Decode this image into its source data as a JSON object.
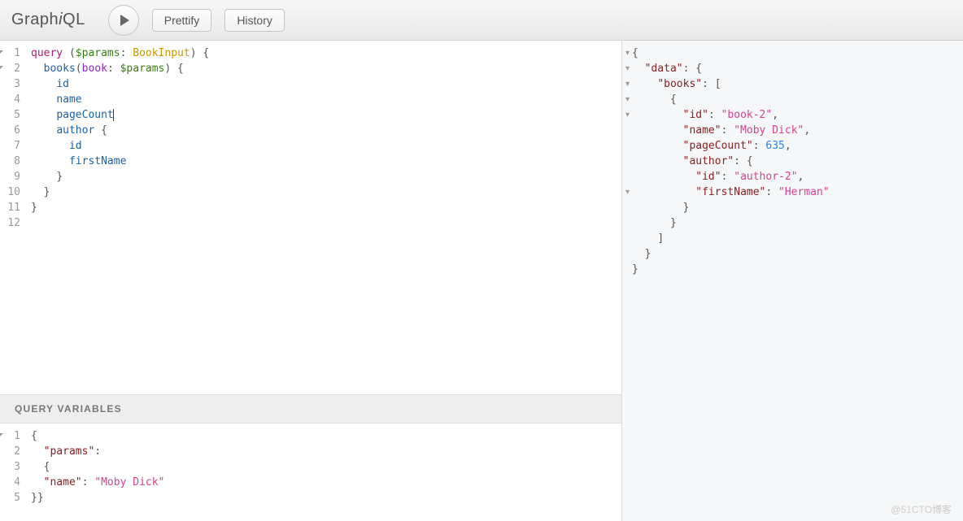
{
  "logo": "GraphiQL",
  "toolbar": {
    "prettify_label": "Prettify",
    "history_label": "History"
  },
  "query_editor": {
    "line_numbers": [
      "1",
      "2",
      "3",
      "4",
      "5",
      "6",
      "7",
      "8",
      "9",
      "10",
      "11",
      "12"
    ],
    "fold_lines": [
      1,
      2
    ],
    "tokens": [
      [
        {
          "t": "kw",
          "v": "query"
        },
        {
          "t": "sp",
          "v": " "
        },
        {
          "t": "punct",
          "v": "("
        },
        {
          "t": "var",
          "v": "$params"
        },
        {
          "t": "punct",
          "v": ": "
        },
        {
          "t": "type",
          "v": "BookInput"
        },
        {
          "t": "punct",
          "v": ") {"
        }
      ],
      [
        {
          "t": "sp",
          "v": "  "
        },
        {
          "t": "field",
          "v": "books"
        },
        {
          "t": "punct",
          "v": "("
        },
        {
          "t": "arg",
          "v": "book"
        },
        {
          "t": "punct",
          "v": ": "
        },
        {
          "t": "var",
          "v": "$params"
        },
        {
          "t": "punct",
          "v": ") {"
        }
      ],
      [
        {
          "t": "sp",
          "v": "    "
        },
        {
          "t": "field",
          "v": "id"
        }
      ],
      [
        {
          "t": "sp",
          "v": "    "
        },
        {
          "t": "field",
          "v": "name"
        }
      ],
      [
        {
          "t": "sp",
          "v": "    "
        },
        {
          "t": "field",
          "v": "pageCount"
        },
        {
          "t": "cursor",
          "v": ""
        }
      ],
      [
        {
          "t": "sp",
          "v": "    "
        },
        {
          "t": "field",
          "v": "author"
        },
        {
          "t": "punct",
          "v": " {"
        }
      ],
      [
        {
          "t": "sp",
          "v": "      "
        },
        {
          "t": "field",
          "v": "id"
        }
      ],
      [
        {
          "t": "sp",
          "v": "      "
        },
        {
          "t": "field",
          "v": "firstName"
        }
      ],
      [
        {
          "t": "sp",
          "v": "    "
        },
        {
          "t": "punct",
          "v": "}"
        }
      ],
      [
        {
          "t": "sp",
          "v": "  "
        },
        {
          "t": "punct",
          "v": "}"
        }
      ],
      [
        {
          "t": "punct",
          "v": "}"
        }
      ],
      []
    ]
  },
  "variables_header": "Query Variables",
  "variables_editor": {
    "line_numbers": [
      "1",
      "2",
      "3",
      "4",
      "5"
    ],
    "fold_lines": [
      1
    ],
    "tokens": [
      [
        {
          "t": "punct",
          "v": "{"
        }
      ],
      [
        {
          "t": "sp",
          "v": "  "
        },
        {
          "t": "key",
          "v": "\"params\""
        },
        {
          "t": "punct",
          "v": ":"
        }
      ],
      [
        {
          "t": "sp",
          "v": "  "
        },
        {
          "t": "punct",
          "v": "{"
        }
      ],
      [
        {
          "t": "sp",
          "v": "  "
        },
        {
          "t": "key",
          "v": "\"name\""
        },
        {
          "t": "punct",
          "v": ": "
        },
        {
          "t": "str",
          "v": "\"Moby Dick\""
        }
      ],
      [
        {
          "t": "punct",
          "v": "}}"
        }
      ]
    ]
  },
  "result": {
    "fold_rows": [
      0,
      1,
      2,
      3,
      4,
      9
    ],
    "tokens": [
      [
        {
          "t": "punct",
          "v": "{"
        }
      ],
      [
        {
          "t": "sp",
          "v": "  "
        },
        {
          "t": "key",
          "v": "\"data\""
        },
        {
          "t": "punct",
          "v": ": {"
        }
      ],
      [
        {
          "t": "sp",
          "v": "    "
        },
        {
          "t": "key",
          "v": "\"books\""
        },
        {
          "t": "punct",
          "v": ": ["
        }
      ],
      [
        {
          "t": "sp",
          "v": "      "
        },
        {
          "t": "punct",
          "v": "{"
        }
      ],
      [
        {
          "t": "sp",
          "v": "        "
        },
        {
          "t": "key",
          "v": "\"id\""
        },
        {
          "t": "punct",
          "v": ": "
        },
        {
          "t": "str",
          "v": "\"book-2\""
        },
        {
          "t": "punct",
          "v": ","
        }
      ],
      [
        {
          "t": "sp",
          "v": "        "
        },
        {
          "t": "key",
          "v": "\"name\""
        },
        {
          "t": "punct",
          "v": ": "
        },
        {
          "t": "str",
          "v": "\"Moby Dick\""
        },
        {
          "t": "punct",
          "v": ","
        }
      ],
      [
        {
          "t": "sp",
          "v": "        "
        },
        {
          "t": "key",
          "v": "\"pageCount\""
        },
        {
          "t": "punct",
          "v": ": "
        },
        {
          "t": "num",
          "v": "635"
        },
        {
          "t": "punct",
          "v": ","
        }
      ],
      [
        {
          "t": "sp",
          "v": "        "
        },
        {
          "t": "key",
          "v": "\"author\""
        },
        {
          "t": "punct",
          "v": ": {"
        }
      ],
      [
        {
          "t": "sp",
          "v": "          "
        },
        {
          "t": "key",
          "v": "\"id\""
        },
        {
          "t": "punct",
          "v": ": "
        },
        {
          "t": "str",
          "v": "\"author-2\""
        },
        {
          "t": "punct",
          "v": ","
        }
      ],
      [
        {
          "t": "sp",
          "v": "          "
        },
        {
          "t": "key",
          "v": "\"firstName\""
        },
        {
          "t": "punct",
          "v": ": "
        },
        {
          "t": "str",
          "v": "\"Herman\""
        }
      ],
      [
        {
          "t": "sp",
          "v": "        "
        },
        {
          "t": "punct",
          "v": "}"
        }
      ],
      [
        {
          "t": "sp",
          "v": "      "
        },
        {
          "t": "punct",
          "v": "}"
        }
      ],
      [
        {
          "t": "sp",
          "v": "    "
        },
        {
          "t": "punct",
          "v": "]"
        }
      ],
      [
        {
          "t": "sp",
          "v": "  "
        },
        {
          "t": "punct",
          "v": "}"
        }
      ],
      [
        {
          "t": "punct",
          "v": "}"
        }
      ]
    ]
  },
  "watermark": "@51CTO博客"
}
